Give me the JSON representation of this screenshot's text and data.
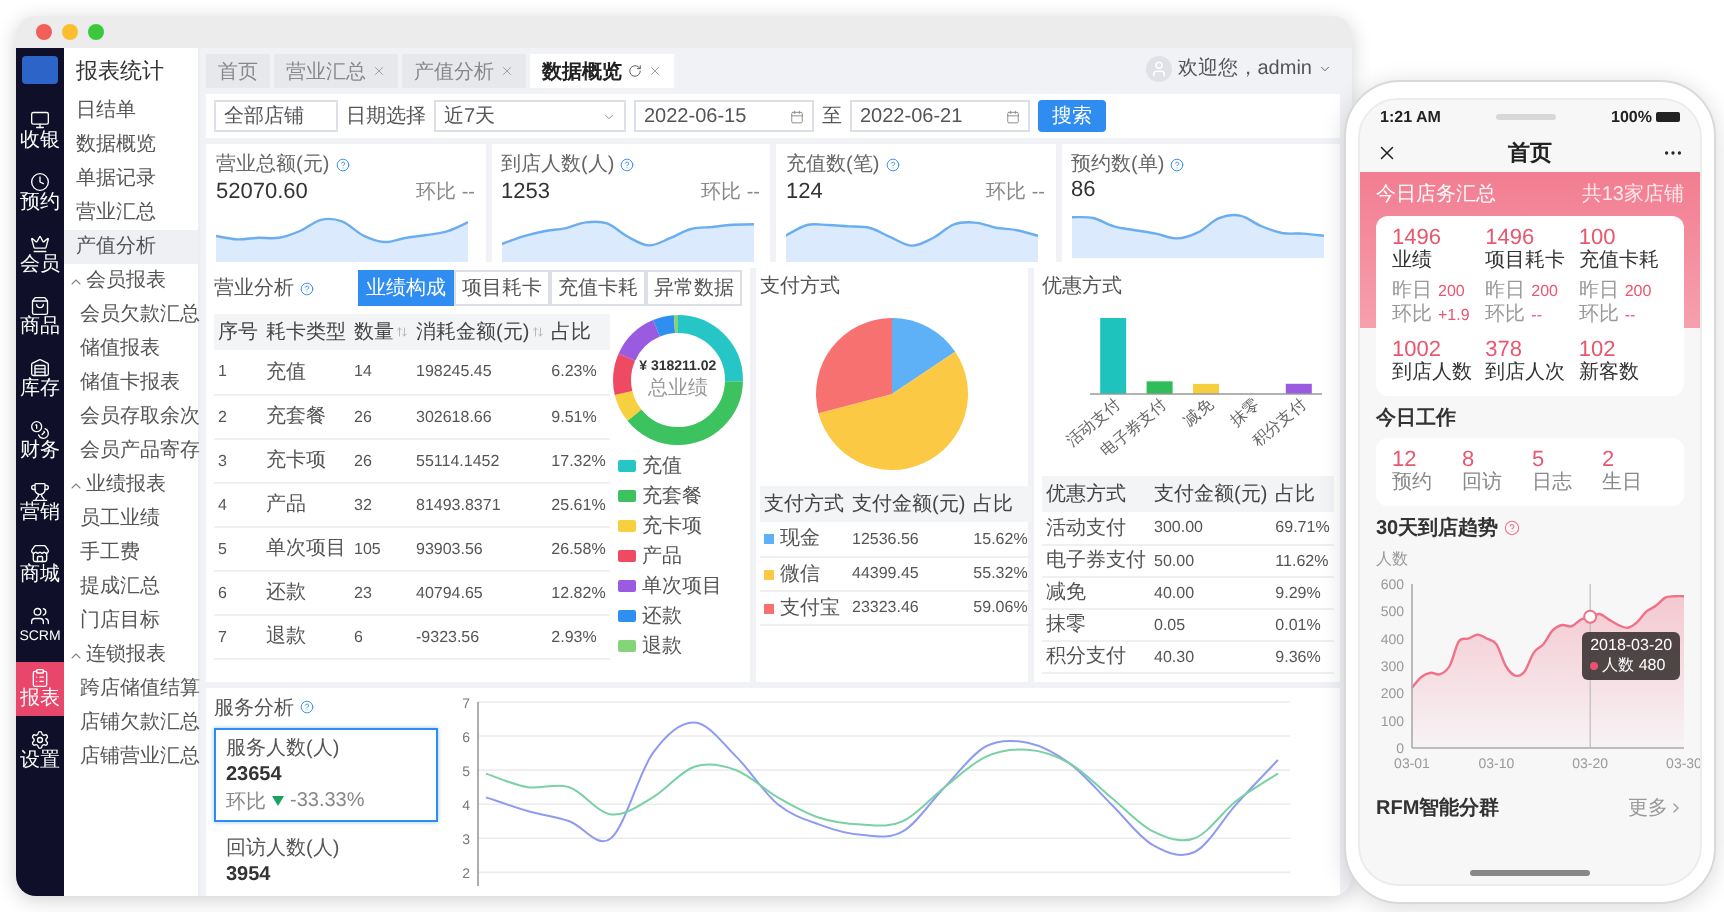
{
  "desktop": {
    "nav": [
      {
        "label": "收银",
        "selected": false
      },
      {
        "label": "预约",
        "selected": false
      },
      {
        "label": "会员",
        "selected": false
      },
      {
        "label": "商品",
        "selected": false
      },
      {
        "label": "库存",
        "selected": false
      },
      {
        "label": "财务",
        "selected": false
      },
      {
        "label": "营销",
        "selected": false
      },
      {
        "label": "商城",
        "selected": false
      },
      {
        "label": "SCRM",
        "selected": false
      },
      {
        "label": "报表",
        "selected": true
      },
      {
        "label": "设置",
        "selected": false
      }
    ],
    "menu": {
      "title": "报表统计",
      "items": [
        {
          "label": "日结单",
          "selected": false
        },
        {
          "label": "数据概览",
          "selected": false
        },
        {
          "label": "单据记录",
          "selected": false
        },
        {
          "label": "营业汇总",
          "selected": false
        },
        {
          "label": "产值分析",
          "selected": true
        }
      ],
      "groups": [
        {
          "label": "会员报表",
          "expanded": true,
          "children": [
            {
              "label": "会员欠款汇总",
              "selected": false
            },
            {
              "label": "储值报表",
              "selected": false
            },
            {
              "label": "储值卡报表",
              "selected": false
            },
            {
              "label": "会员存取余次",
              "selected": false
            },
            {
              "label": "会员产品寄存",
              "selected": false
            }
          ]
        },
        {
          "label": "业绩报表",
          "expanded": true,
          "children": [
            {
              "label": "员工业绩",
              "selected": false
            },
            {
              "label": "手工费",
              "selected": false
            },
            {
              "label": "提成汇总",
              "selected": false
            },
            {
              "label": "门店目标",
              "selected": false
            }
          ]
        },
        {
          "label": "连锁报表",
          "expanded": true,
          "children": [
            {
              "label": "跨店储值结算",
              "selected": false
            },
            {
              "label": "店铺欠款汇总",
              "selected": false
            },
            {
              "label": "店铺营业汇总",
              "selected": false
            }
          ]
        }
      ]
    },
    "tabs": [
      {
        "label": "首页",
        "selected": false,
        "closable": false
      },
      {
        "label": "营业汇总",
        "selected": false,
        "closable": true
      },
      {
        "label": "产值分析",
        "selected": false,
        "closable": true
      },
      {
        "label": "数据概览",
        "selected": true,
        "closable": true
      }
    ],
    "user": {
      "greeting": "欢迎您，admin"
    },
    "filters": {
      "store": "全部店铺",
      "date_label": "日期选择",
      "range": "近7天",
      "start": "2022-06-15",
      "separator": "至",
      "end": "2022-06-21",
      "search_button": "搜索"
    },
    "stats": [
      {
        "title": "营业总额(元)",
        "value": "52070.60",
        "compare": "环比 --"
      },
      {
        "title": "到店人数(人)",
        "value": "1253",
        "compare": "环比 --"
      },
      {
        "title": "充值数(笔)",
        "value": "124",
        "compare": "环比 --"
      },
      {
        "title": "预约数(单)",
        "value": "86"
      }
    ],
    "revenue": {
      "title": "营业分析",
      "modes": [
        {
          "label": "业绩构成",
          "selected": true
        },
        {
          "label": "项目耗卡",
          "selected": false
        },
        {
          "label": "充值卡耗",
          "selected": false
        },
        {
          "label": "异常数据",
          "selected": false
        }
      ],
      "columns": [
        "序号",
        "耗卡类型",
        "数量",
        "消耗金额(元)",
        "占比"
      ],
      "rows": [
        [
          "1",
          "充值",
          "14",
          "198245.45",
          "6.23%"
        ],
        [
          "2",
          "充套餐",
          "26",
          "302618.66",
          "9.51%"
        ],
        [
          "3",
          "充卡项",
          "26",
          "55114.1452",
          "17.32%"
        ],
        [
          "4",
          "产品",
          "32",
          "81493.8371",
          "25.61%"
        ],
        [
          "5",
          "单次项目",
          "105",
          "93903.56",
          "26.58%"
        ],
        [
          "6",
          "还款",
          "23",
          "40794.65",
          "12.82%"
        ],
        [
          "7",
          "退款",
          "6",
          "-9323.56",
          "2.93%"
        ]
      ],
      "donut_total": "¥ 318211.02",
      "donut_caption": "总业绩",
      "legend": [
        {
          "label": "充值",
          "color": "#26c6c6"
        },
        {
          "label": "充套餐",
          "color": "#3cc25e"
        },
        {
          "label": "充卡项",
          "color": "#f7d03f"
        },
        {
          "label": "产品",
          "color": "#ee4a64"
        },
        {
          "label": "单次项目",
          "color": "#9a5be0"
        },
        {
          "label": "还款",
          "color": "#2f8ff0"
        },
        {
          "label": "退款",
          "color": "#86d47a"
        }
      ]
    },
    "payment": {
      "title": "支付方式",
      "columns": [
        "支付方式",
        "支付金额(元)",
        "占比"
      ],
      "rows": [
        {
          "method": "现金",
          "color": "#5eb0f7",
          "amount": "12536.56",
          "share": "15.62%"
        },
        {
          "method": "微信",
          "color": "#fcc944",
          "amount": "44399.45",
          "share": "55.32%"
        },
        {
          "method": "支付宝",
          "color": "#f6716f",
          "amount": "23323.46",
          "share": "59.06%"
        }
      ]
    },
    "discount": {
      "title": "优惠方式",
      "axis_labels": [
        "活动支付",
        "电子券支付",
        "减免",
        "抹零",
        "积分支付"
      ],
      "columns": [
        "优惠方式",
        "支付金额(元)",
        "占比"
      ],
      "rows": [
        [
          "活动支付",
          "300.00",
          "69.71%"
        ],
        [
          "电子券支付",
          "50.00",
          "11.62%"
        ],
        [
          "减免",
          "40.00",
          "9.29%"
        ],
        [
          "抹零",
          "0.05",
          "0.01%"
        ],
        [
          "积分支付",
          "40.30",
          "9.36%"
        ]
      ]
    },
    "service": {
      "title": "服务分析",
      "cards": [
        {
          "title": "服务人数(人)",
          "value": "23654",
          "compare": "环比",
          "falling": true,
          "change": "-33.33%",
          "selected": true
        },
        {
          "title": "回访人数(人)",
          "value": "3954",
          "selected": false
        }
      ],
      "chart_data": {
        "type": "line",
        "grid": true,
        "yticks": [
          2,
          3,
          4,
          5,
          6,
          7
        ],
        "ylim": [
          1.6,
          7
        ],
        "series": [
          {
            "color": "#8e9bf0",
            "values": [
              4.2,
              3.8,
              3.5,
              3.0,
              5.5,
              6.4,
              5.4,
              4.0,
              3.4,
              3.1,
              3.2,
              4.5,
              5.7,
              5.8,
              5.2,
              4.0,
              2.8,
              2.6,
              4.0,
              5.3
            ]
          },
          {
            "color": "#79d1a5",
            "values": [
              4.9,
              4.5,
              4.5,
              3.7,
              4.2,
              5.1,
              5.0,
              4.2,
              3.6,
              3.4,
              3.5,
              4.5,
              5.4,
              5.6,
              5.2,
              4.2,
              3.2,
              3.0,
              4.1,
              4.9
            ]
          }
        ]
      }
    }
  },
  "phone": {
    "time": "1:21 AM",
    "battery": "100%",
    "title": "首页",
    "summary": {
      "title": "今日店务汇总",
      "stores": "共13家店铺",
      "metrics": [
        {
          "value": "1496",
          "label": "业绩",
          "yesterday_label": "昨日",
          "yesterday": "200",
          "ratio_label": "环比",
          "ratio": "+1.9"
        },
        {
          "value": "1496",
          "label": "项目耗卡",
          "yesterday_label": "昨日",
          "yesterday": "200",
          "ratio_label": "环比",
          "ratio": "--"
        },
        {
          "value": "100",
          "label": "充值卡耗",
          "yesterday_label": "昨日",
          "yesterday": "200",
          "ratio_label": "环比",
          "ratio": "--"
        }
      ],
      "visits": [
        {
          "value": "1002",
          "label": "到店人数"
        },
        {
          "value": "378",
          "label": "到店人次"
        },
        {
          "value": "102",
          "label": "新客数"
        }
      ]
    },
    "work": {
      "title": "今日工作",
      "items": [
        {
          "value": "12",
          "label": "预约"
        },
        {
          "value": "8",
          "label": "回访"
        },
        {
          "value": "5",
          "label": "日志"
        },
        {
          "value": "2",
          "label": "生日"
        }
      ]
    },
    "trend": {
      "title": "30天到店趋势",
      "unit": "人数",
      "tooltip": {
        "date": "2018-03-20",
        "text": "人数 480"
      },
      "chart_data": {
        "type": "area",
        "categories": [
          "03-01",
          null,
          null,
          null,
          null,
          null,
          null,
          null,
          null,
          "03-10",
          null,
          null,
          null,
          null,
          null,
          null,
          null,
          null,
          null,
          "03-20",
          null,
          null,
          null,
          null,
          null,
          null,
          null,
          null,
          null,
          "03-30"
        ],
        "series": [
          {
            "color": "#ef7288",
            "values": [
              220,
              260,
              275,
              270,
              300,
              390,
              400,
              415,
              400,
              380,
              300,
              265,
              280,
              350,
              380,
              430,
              450,
              445,
              470,
              480,
              490,
              470,
              450,
              440,
              460,
              500,
              520,
              550,
              555,
              555
            ]
          }
        ],
        "ylim": [
          0,
          600
        ],
        "yticks": [
          0,
          100,
          200,
          300,
          400,
          500,
          600
        ]
      }
    },
    "rfm": {
      "title": "RFM智能分群",
      "more": "更多"
    }
  }
}
